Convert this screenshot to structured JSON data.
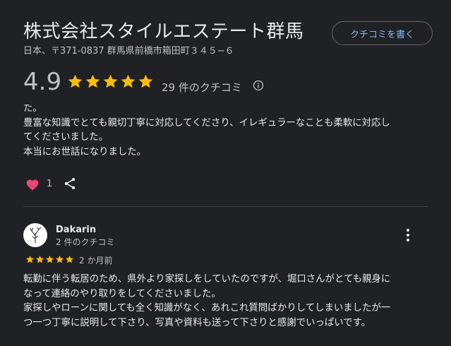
{
  "business": {
    "name": "株式会社スタイルエステート群馬",
    "address": "日本、〒371-0837 群馬県前橋市箱田町３４５−６"
  },
  "write_review_label": "クチコミを書く",
  "summary": {
    "rating": "4.9",
    "stars": 5,
    "review_count": "29 件のクチコミ"
  },
  "review1": {
    "lines": [
      "た。",
      "豊富な知識でとても親切丁寧に対応してくださり、イレギュラーなことも柔軟に対応し",
      "てくださいました。",
      "本当にお世話になりました。"
    ],
    "likes": "1"
  },
  "review2": {
    "author": "Dakarin",
    "author_meta": "2 件のクチコミ",
    "stars": 5,
    "date": "2 か月前",
    "lines": [
      "転勤に伴う転居のため、県外より家探しをしていたのですが、堀口さんがとても親身に",
      "なって連絡のやり取りをしてくださいました。",
      "家探しやローンに関しても全く知識がなく、あれこれ質問ばかりしてしまいましたが一",
      "つ一つ丁寧に説明して下さり、写真や資料も送って下さりと感謝でいっぱいです。"
    ]
  },
  "colors": {
    "background": "#202124",
    "star": "#fbbc04",
    "link": "#8ab4f8",
    "heart": "#e8457a"
  }
}
